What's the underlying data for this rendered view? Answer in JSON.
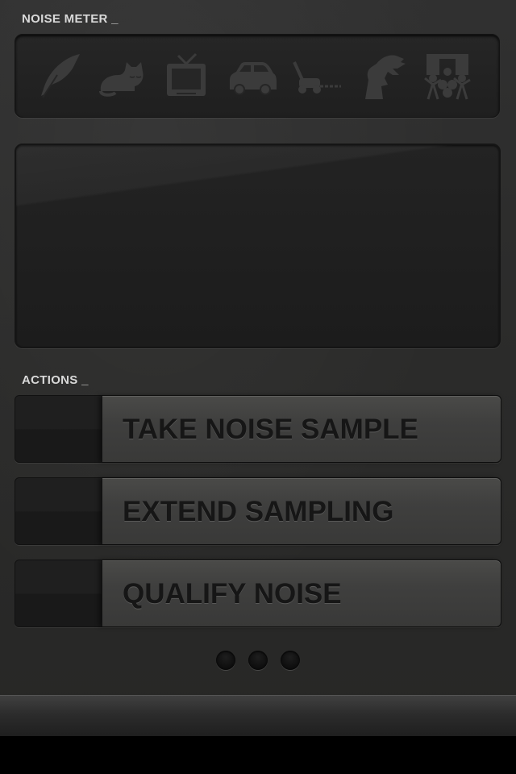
{
  "noise_meter": {
    "label": "NOISE METER _",
    "icons": [
      {
        "name": "feather-icon"
      },
      {
        "name": "sleeping-cat-icon"
      },
      {
        "name": "television-icon"
      },
      {
        "name": "car-icon"
      },
      {
        "name": "lawn-mower-icon"
      },
      {
        "name": "t-rex-icon"
      },
      {
        "name": "concert-crowd-icon"
      }
    ]
  },
  "actions": {
    "label": "ACTIONS _",
    "buttons": [
      {
        "label": "TAKE NOISE SAMPLE"
      },
      {
        "label": "EXTEND SAMPLING"
      },
      {
        "label": "QUALIFY NOISE"
      }
    ]
  },
  "pager": {
    "pages": 3
  },
  "colors": {
    "background": "#2b2b2a",
    "icon": "#3b3b3b",
    "button_plate": "#434342",
    "button_text": "#161616",
    "label_text": "#d9d9d9"
  }
}
